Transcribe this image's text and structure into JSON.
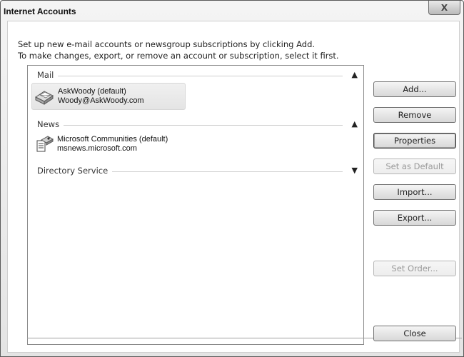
{
  "window": {
    "title": "Internet Accounts",
    "close_glyph": "X"
  },
  "intro": {
    "line1": "Set up new e-mail accounts or newsgroup subscriptions by clicking Add.",
    "line2": "To make changes, export, or remove an account or subscription, select it first."
  },
  "groups": [
    {
      "label": "Mail",
      "expanded": true,
      "chevron": "up",
      "accounts": [
        {
          "name": "AskWoody (default)",
          "detail": "Woody@AskWoody.com",
          "icon": "mail-account-icon",
          "selected": true
        }
      ]
    },
    {
      "label": "News",
      "expanded": true,
      "chevron": "up",
      "accounts": [
        {
          "name": "Microsoft Communities (default)",
          "detail": "msnews.microsoft.com",
          "icon": "news-account-icon",
          "selected": false
        }
      ]
    },
    {
      "label": "Directory Service",
      "expanded": false,
      "chevron": "down",
      "accounts": []
    }
  ],
  "buttons": {
    "add": "Add...",
    "remove": "Remove",
    "properties": "Properties",
    "set_default": "Set as Default",
    "import": "Import...",
    "export": "Export...",
    "set_order": "Set Order...",
    "close": "Close"
  },
  "button_states": {
    "set_default": "disabled",
    "set_order": "disabled",
    "properties": "focused"
  },
  "colors": {
    "selection": "#e8e8e8",
    "disabled_text": "#9a9a9a"
  }
}
